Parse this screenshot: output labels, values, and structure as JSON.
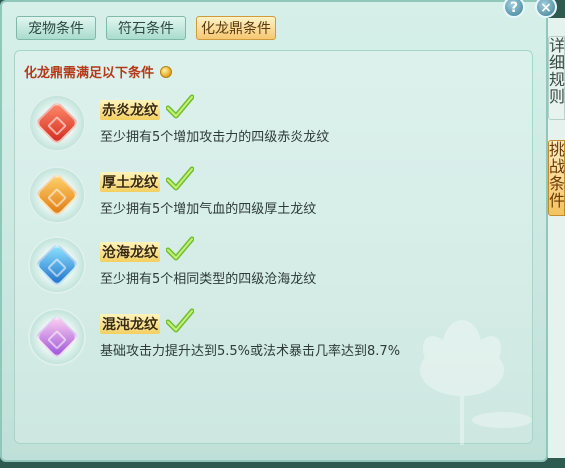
{
  "tabs": [
    {
      "label": "宠物条件"
    },
    {
      "label": "符石条件"
    },
    {
      "label": "化龙鼎条件"
    }
  ],
  "header": {
    "text": "化龙鼎需满足以下条件"
  },
  "requirements": [
    {
      "name": "赤炎龙纹",
      "desc": "至少拥有5个增加攻击力的四级赤炎龙纹",
      "met": true,
      "gem_color": "#e2452f"
    },
    {
      "name": "厚土龙纹",
      "desc": "至少拥有5个增加气血的四级厚土龙纹",
      "met": true,
      "gem_color": "#f0a126"
    },
    {
      "name": "沧海龙纹",
      "desc": "至少拥有5个相同类型的四级沧海龙纹",
      "met": true,
      "gem_color": "#2e9bd9"
    },
    {
      "name": "混沌龙纹",
      "desc": "基础攻击力提升达到5.5%或法术暴击几率达到8.7%",
      "met": true,
      "gem_color": "#b77be0"
    }
  ],
  "side": {
    "detail_label": "详细规则",
    "challenge_label": "挑战条件"
  },
  "window_buttons": {
    "help": "?",
    "close": "×"
  }
}
